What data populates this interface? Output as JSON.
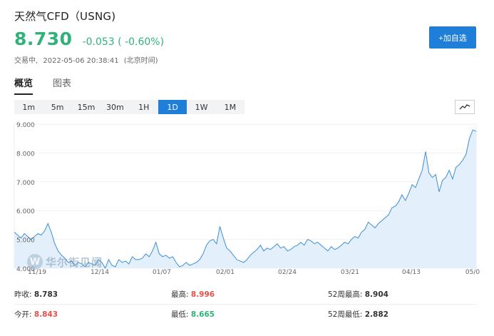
{
  "header": {
    "title": "天然气CFD（USNG)",
    "price": "8.730",
    "change": "-0.053 ( -0.60%)",
    "status": "交易中,",
    "datetime": "2022-05-06 20:38:41",
    "timezone": "(北京时间)",
    "watch_button": "+加自选"
  },
  "tabs": [
    {
      "label": "概览",
      "active": true
    },
    {
      "label": "图表",
      "active": false
    }
  ],
  "periods": [
    {
      "label": "1m",
      "active": false
    },
    {
      "label": "5m",
      "active": false
    },
    {
      "label": "15m",
      "active": false
    },
    {
      "label": "30m",
      "active": false
    },
    {
      "label": "1H",
      "active": false
    },
    {
      "label": "1D",
      "active": true
    },
    {
      "label": "1W",
      "active": false
    },
    {
      "label": "1M",
      "active": false
    }
  ],
  "chart_type_icon": "line-chart-icon",
  "watermark": "华尔街见闻",
  "chart_data": {
    "type": "area",
    "ylim": [
      4.0,
      9.0
    ],
    "y_ticks": [
      "4.000",
      "5.000",
      "6.000",
      "7.000",
      "8.000",
      "9.000"
    ],
    "x_labels": [
      "11/19",
      "12/14",
      "01/07",
      "02/01",
      "02/24",
      "03/21",
      "04/13",
      "05/0"
    ],
    "values": [
      5.25,
      5.15,
      5.05,
      5.2,
      5.1,
      5.0,
      5.1,
      5.2,
      5.15,
      5.3,
      5.55,
      5.25,
      4.85,
      4.6,
      4.45,
      4.35,
      4.2,
      4.25,
      4.1,
      4.2,
      4.15,
      4.05,
      4.2,
      4.15,
      4.1,
      4.3,
      4.2,
      4.0,
      4.3,
      4.1,
      4.05,
      4.3,
      4.2,
      4.25,
      4.15,
      4.4,
      4.3,
      4.3,
      4.35,
      4.5,
      4.4,
      4.6,
      4.9,
      4.5,
      4.4,
      4.45,
      4.35,
      4.4,
      4.2,
      4.05,
      4.1,
      4.2,
      4.1,
      4.15,
      4.2,
      4.3,
      4.5,
      4.8,
      4.95,
      5.0,
      4.85,
      5.45,
      5.05,
      4.7,
      4.6,
      4.45,
      4.3,
      4.25,
      4.2,
      4.3,
      4.45,
      4.55,
      4.65,
      4.8,
      4.6,
      4.7,
      4.65,
      4.75,
      4.85,
      4.7,
      4.75,
      4.6,
      4.65,
      4.75,
      4.8,
      4.9,
      4.8,
      5.0,
      4.95,
      4.85,
      4.9,
      4.8,
      4.7,
      4.6,
      4.75,
      4.65,
      4.7,
      4.8,
      4.9,
      4.85,
      5.0,
      5.1,
      5.05,
      5.25,
      5.35,
      5.6,
      5.5,
      5.4,
      5.55,
      5.65,
      5.75,
      5.85,
      6.1,
      6.15,
      6.3,
      6.55,
      6.35,
      6.6,
      6.9,
      6.8,
      7.1,
      7.4,
      8.05,
      7.3,
      7.15,
      7.25,
      6.65,
      7.05,
      7.15,
      7.4,
      7.1,
      7.5,
      7.6,
      7.75,
      7.95,
      8.5,
      8.8,
      8.75
    ]
  },
  "stats": {
    "prev_close_label": "昨收:",
    "prev_close": "8.783",
    "high_label": "最高:",
    "high": "8.996",
    "week52_high_label": "52周最高:",
    "week52_high": "8.904",
    "open_label": "今开:",
    "open": "8.843",
    "low_label": "最低:",
    "low": "8.665",
    "week52_low_label": "52周最低:",
    "week52_low": "2.882",
    "colors": {
      "up": "#e8504c",
      "down": "#2fb37a",
      "line": "#3d8fd6",
      "area": "#e3f0fb"
    }
  }
}
